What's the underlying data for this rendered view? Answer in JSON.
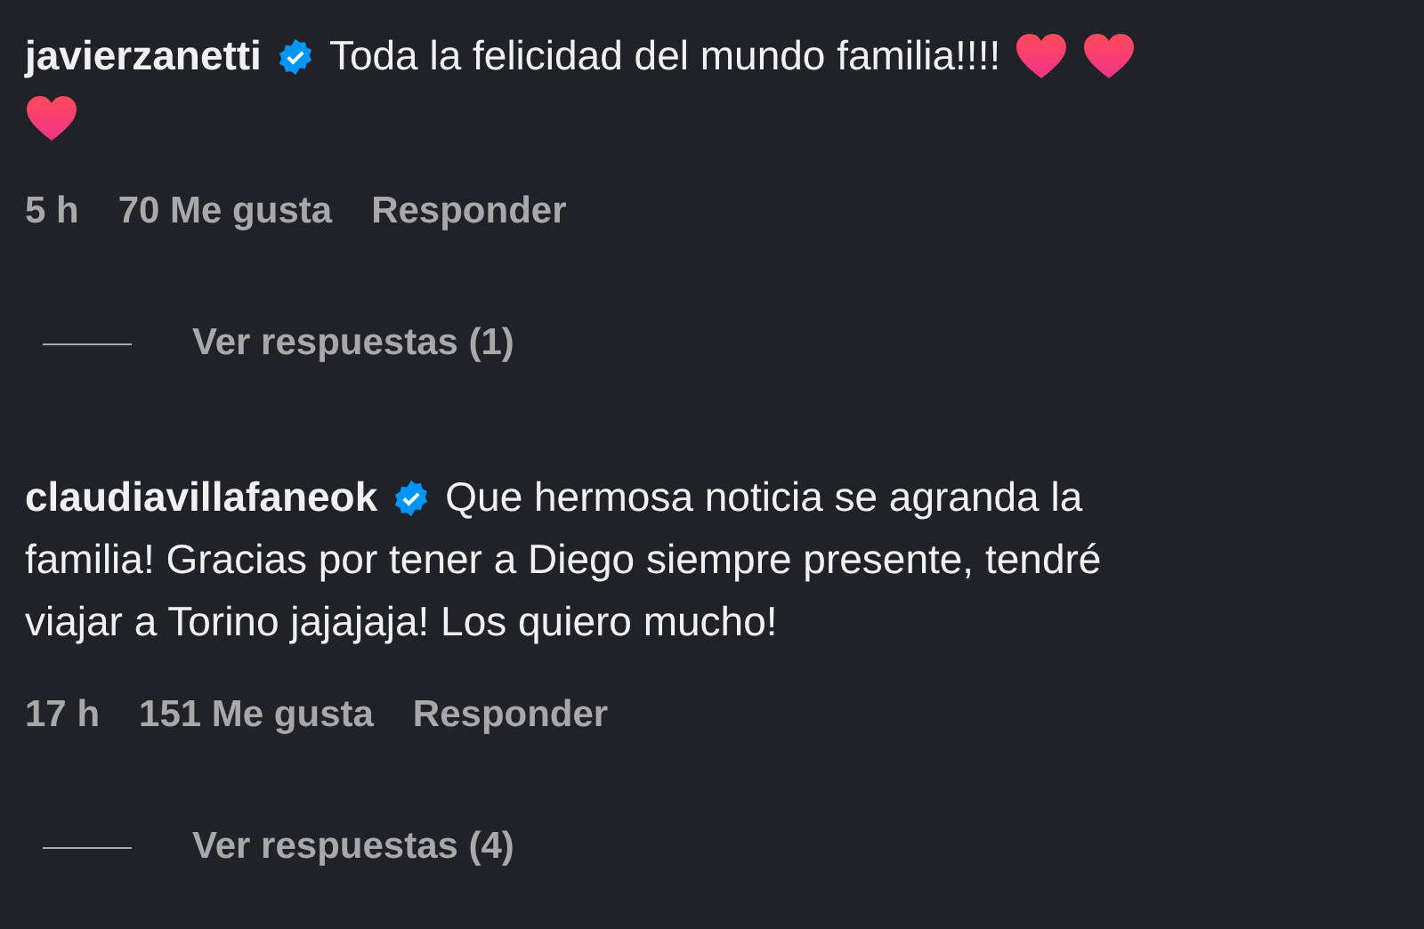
{
  "comments": [
    {
      "username": "javierzanetti",
      "verified": true,
      "lines": [
        {
          "text": "Toda la felicidad del mundo familia!!!!",
          "emoji": [
            {
              "kind": "heart"
            },
            {
              "kind": "heart"
            }
          ]
        },
        {
          "emoji": [
            {
              "kind": "heart"
            }
          ]
        }
      ],
      "time": "5 h",
      "likes": "70 Me gusta",
      "reply": "Responder",
      "view_replies": "Ver respuestas (1)"
    },
    {
      "username": "claudiavillafaneok",
      "verified": true,
      "lines": [
        {
          "text": "Que hermosa noticia se agranda la"
        },
        {
          "text": "familia! Gracias por tener a Diego siempre presente, tendré"
        },
        {
          "text": "viajar a Torino jajajaja! Los quiero mucho!"
        }
      ],
      "time": "17 h",
      "likes": "151 Me gusta",
      "reply": "Responder",
      "view_replies": "Ver respuestas (4)"
    }
  ]
}
